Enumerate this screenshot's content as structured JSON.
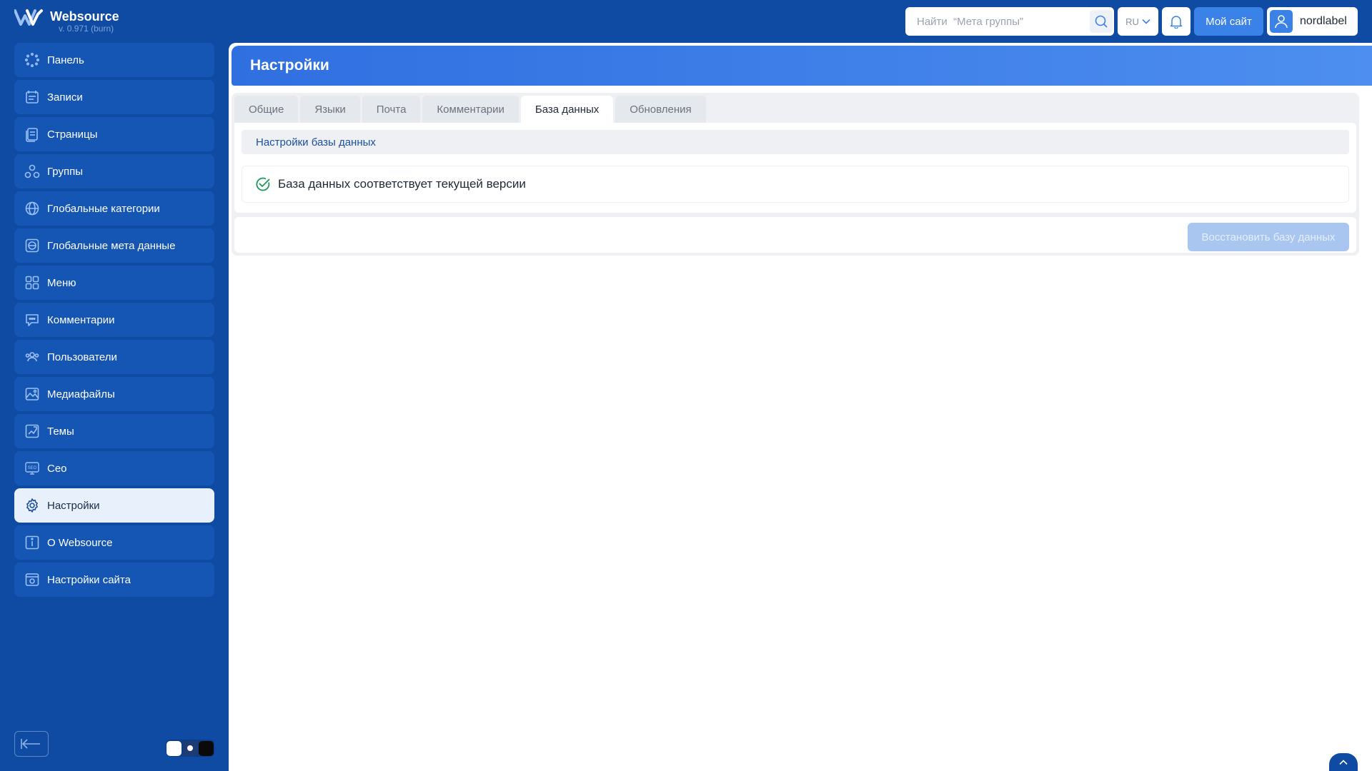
{
  "app": {
    "name": "Websource",
    "version": "v. 0.971 (burn)"
  },
  "sidebar": {
    "items": [
      {
        "label": "Панель",
        "icon": "dashboard-icon"
      },
      {
        "label": "Записи",
        "icon": "records-icon"
      },
      {
        "label": "Страницы",
        "icon": "pages-icon"
      },
      {
        "label": "Группы",
        "icon": "groups-icon"
      },
      {
        "label": "Глобальные категории",
        "icon": "global-categories-icon"
      },
      {
        "label": "Глобальные мета данные",
        "icon": "global-meta-icon"
      },
      {
        "label": "Меню",
        "icon": "menu-grid-icon"
      },
      {
        "label": "Комментарии",
        "icon": "comments-icon"
      },
      {
        "label": "Пользователи",
        "icon": "users-icon"
      },
      {
        "label": "Медиафайлы",
        "icon": "media-icon"
      },
      {
        "label": "Темы",
        "icon": "themes-icon"
      },
      {
        "label": "Сео",
        "icon": "seo-icon"
      },
      {
        "label": "Настройки",
        "icon": "gear-icon",
        "active": true
      },
      {
        "label": "O Websource",
        "icon": "info-icon"
      },
      {
        "label": "Настройки сайта",
        "icon": "site-settings-icon"
      }
    ]
  },
  "header": {
    "search_placeholder": "Найти  “Мета группы”",
    "language": "RU",
    "my_site_label": "Мой сайт",
    "username": "nordlabel"
  },
  "page": {
    "title": "Настройки",
    "tabs": [
      {
        "label": "Общие",
        "active": false
      },
      {
        "label": "Языки",
        "active": false
      },
      {
        "label": "Почта",
        "active": false
      },
      {
        "label": "Комментарии",
        "active": false
      },
      {
        "label": "База данных",
        "active": true
      },
      {
        "label": "Обновления",
        "active": false
      }
    ],
    "section_title": "Настройки базы данных",
    "status_text": "База данных соответствует текущей версии",
    "restore_button_label": "Восстановить базу данных"
  },
  "colors": {
    "sidebar_bg": "#0f4ba3",
    "accent": "#3b82e8",
    "success": "#1a9a5a"
  }
}
